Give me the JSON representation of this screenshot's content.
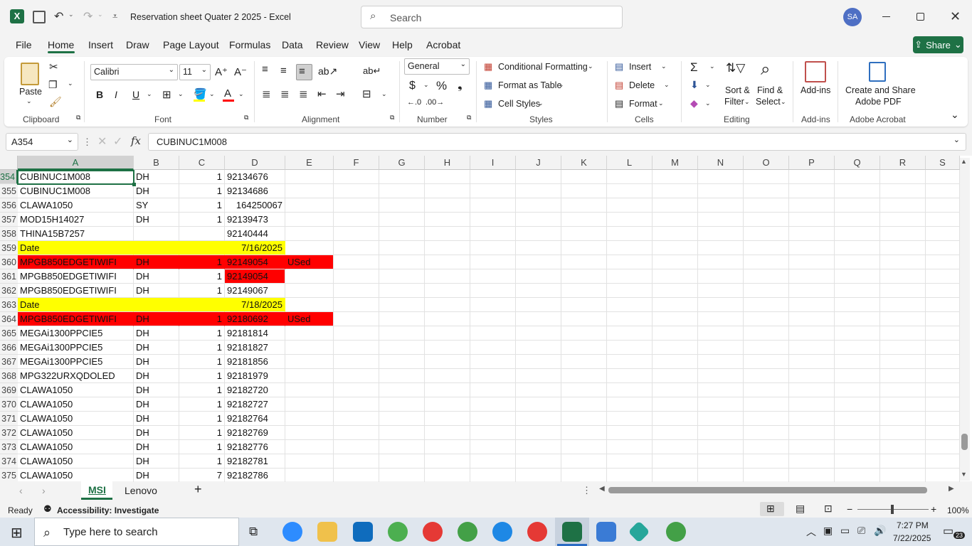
{
  "window": {
    "title": "Reservation sheet Quater 2 2025  -  Excel",
    "search_placeholder": "Search",
    "user_initials": "SA"
  },
  "menu": {
    "items": [
      "File",
      "Home",
      "Insert",
      "Draw",
      "Page Layout",
      "Formulas",
      "Data",
      "Review",
      "View",
      "Help",
      "Acrobat"
    ],
    "share": "Share"
  },
  "ribbon": {
    "clipboard": {
      "paste": "Paste",
      "label": "Clipboard"
    },
    "font": {
      "name": "Calibri",
      "size": "11",
      "label": "Font"
    },
    "alignment": {
      "label": "Alignment"
    },
    "number": {
      "format": "General",
      "label": "Number"
    },
    "styles": {
      "conditional": "Conditional Formatting",
      "table": "Format as Table",
      "cell_styles": "Cell Styles",
      "label": "Styles"
    },
    "cells": {
      "insert": "Insert",
      "delete": "Delete",
      "format": "Format",
      "label": "Cells"
    },
    "editing": {
      "sort": "Sort &",
      "filter": "Filter",
      "find": "Find &",
      "select": "Select",
      "label": "Editing"
    },
    "addins": {
      "btn": "Add-ins",
      "label": "Add-ins"
    },
    "acrobat": {
      "line1": "Create and Share",
      "line2": "Adobe PDF",
      "label": "Adobe Acrobat"
    }
  },
  "formula_bar": {
    "name_box": "A354",
    "fx": "fx",
    "content": "CUBINUC1M008"
  },
  "columns": [
    "A",
    "B",
    "C",
    "D",
    "E",
    "F",
    "G",
    "H",
    "I",
    "J",
    "K",
    "L",
    "M",
    "N",
    "O",
    "P",
    "Q",
    "R",
    "S"
  ],
  "rows": [
    {
      "n": "354",
      "a": "CUBINUC1M008",
      "b": "DH",
      "c": "1",
      "d": "92134676",
      "e": "",
      "style": ""
    },
    {
      "n": "355",
      "a": "CUBINUC1M008",
      "b": "DH",
      "c": "1",
      "d": "92134686",
      "e": "",
      "style": ""
    },
    {
      "n": "356",
      "a": "CLAWA1050",
      "b": "SY",
      "c": "1",
      "d": "164250067",
      "e": "",
      "style": "dright"
    },
    {
      "n": "357",
      "a": "MOD15H14027",
      "b": "DH",
      "c": "1",
      "d": "92139473",
      "e": "",
      "style": ""
    },
    {
      "n": "358",
      "a": "THINA15B7257",
      "b": "",
      "c": "",
      "d": "92140444",
      "e": "",
      "style": ""
    },
    {
      "n": "359",
      "a": "Date",
      "b": "",
      "c": "",
      "d": "7/16/2025",
      "e": "",
      "style": "yellow"
    },
    {
      "n": "360",
      "a": "MPGB850EDGETIWIFI",
      "b": "DH",
      "c": "1",
      "d": "92149054",
      "e": "USed",
      "style": "red"
    },
    {
      "n": "361",
      "a": "MPGB850EDGETIWIFI",
      "b": "DH",
      "c": "1",
      "d": "92149054",
      "e": "",
      "style": "redD"
    },
    {
      "n": "362",
      "a": "MPGB850EDGETIWIFI",
      "b": "DH",
      "c": "1",
      "d": "92149067",
      "e": "",
      "style": ""
    },
    {
      "n": "363",
      "a": "Date",
      "b": "",
      "c": "",
      "d": "7/18/2025",
      "e": "",
      "style": "yellow"
    },
    {
      "n": "364",
      "a": "MPGB850EDGETIWIFI",
      "b": "DH",
      "c": "1",
      "d": "92180692",
      "e": "USed",
      "style": "red"
    },
    {
      "n": "365",
      "a": "MEGAi1300PPCIE5",
      "b": "DH",
      "c": "1",
      "d": "92181814",
      "e": "",
      "style": ""
    },
    {
      "n": "366",
      "a": "MEGAi1300PPCIE5",
      "b": "DH",
      "c": "1",
      "d": "92181827",
      "e": "",
      "style": ""
    },
    {
      "n": "367",
      "a": "MEGAi1300PPCIE5",
      "b": "DH",
      "c": "1",
      "d": "92181856",
      "e": "",
      "style": ""
    },
    {
      "n": "368",
      "a": "MPG322URXQDOLED",
      "b": "DH",
      "c": "1",
      "d": "92181979",
      "e": "",
      "style": ""
    },
    {
      "n": "369",
      "a": "CLAWA1050",
      "b": "DH",
      "c": "1",
      "d": "92182720",
      "e": "",
      "style": ""
    },
    {
      "n": "370",
      "a": "CLAWA1050",
      "b": "DH",
      "c": "1",
      "d": "92182727",
      "e": "",
      "style": ""
    },
    {
      "n": "371",
      "a": "CLAWA1050",
      "b": "DH",
      "c": "1",
      "d": "92182764",
      "e": "",
      "style": ""
    },
    {
      "n": "372",
      "a": "CLAWA1050",
      "b": "DH",
      "c": "1",
      "d": "92182769",
      "e": "",
      "style": ""
    },
    {
      "n": "373",
      "a": "CLAWA1050",
      "b": "DH",
      "c": "1",
      "d": "92182776",
      "e": "",
      "style": ""
    },
    {
      "n": "374",
      "a": "CLAWA1050",
      "b": "DH",
      "c": "1",
      "d": "92182781",
      "e": "",
      "style": ""
    },
    {
      "n": "375",
      "a": "CLAWA1050",
      "b": "DH",
      "c": "7",
      "d": "92182786",
      "e": "",
      "style": ""
    }
  ],
  "sheets": {
    "tabs": [
      "MSI",
      "Lenovo"
    ],
    "active": "MSI"
  },
  "status": {
    "ready": "Ready",
    "accessibility": "Accessibility: Investigate",
    "zoom": "100%"
  },
  "taskbar": {
    "search": "Type here to search",
    "time": "7:27 PM",
    "date": "7/22/2025",
    "notifications": "23"
  },
  "colors": {
    "excel_green": "#1e7145",
    "highlight_yellow": "#ffff00",
    "highlight_red": "#ff0000"
  }
}
